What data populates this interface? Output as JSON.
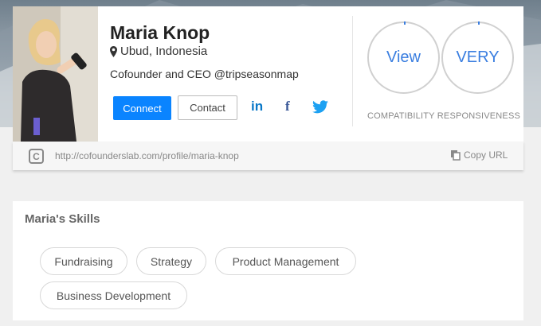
{
  "profile": {
    "name": "Maria Knop",
    "location": "Ubud, Indonesia",
    "headline": "Cofounder and CEO @tripseasonmap",
    "actions": {
      "connect_label": "Connect",
      "contact_label": "Contact"
    },
    "social": {
      "linkedin": "in",
      "facebook": "f"
    }
  },
  "metrics": {
    "compatibility_value": "View",
    "responsiveness_value": "VERY",
    "labels": "COMPATIBILITY RESPONSIVENESS"
  },
  "url_bar": {
    "url": "http://cofounderslab.com/profile/maria-knop",
    "copy_label": "Copy URL",
    "logo_glyph": "C"
  },
  "skills": {
    "title": "Maria's Skills",
    "items": [
      "Fundraising",
      "Strategy",
      "Product Management",
      "Business Development"
    ]
  },
  "colors": {
    "accent": "#0a84ff",
    "metric_text": "#3a7ee0",
    "linkedin": "#0a78c8",
    "facebook": "#3b5998",
    "twitter": "#1da1f2"
  }
}
